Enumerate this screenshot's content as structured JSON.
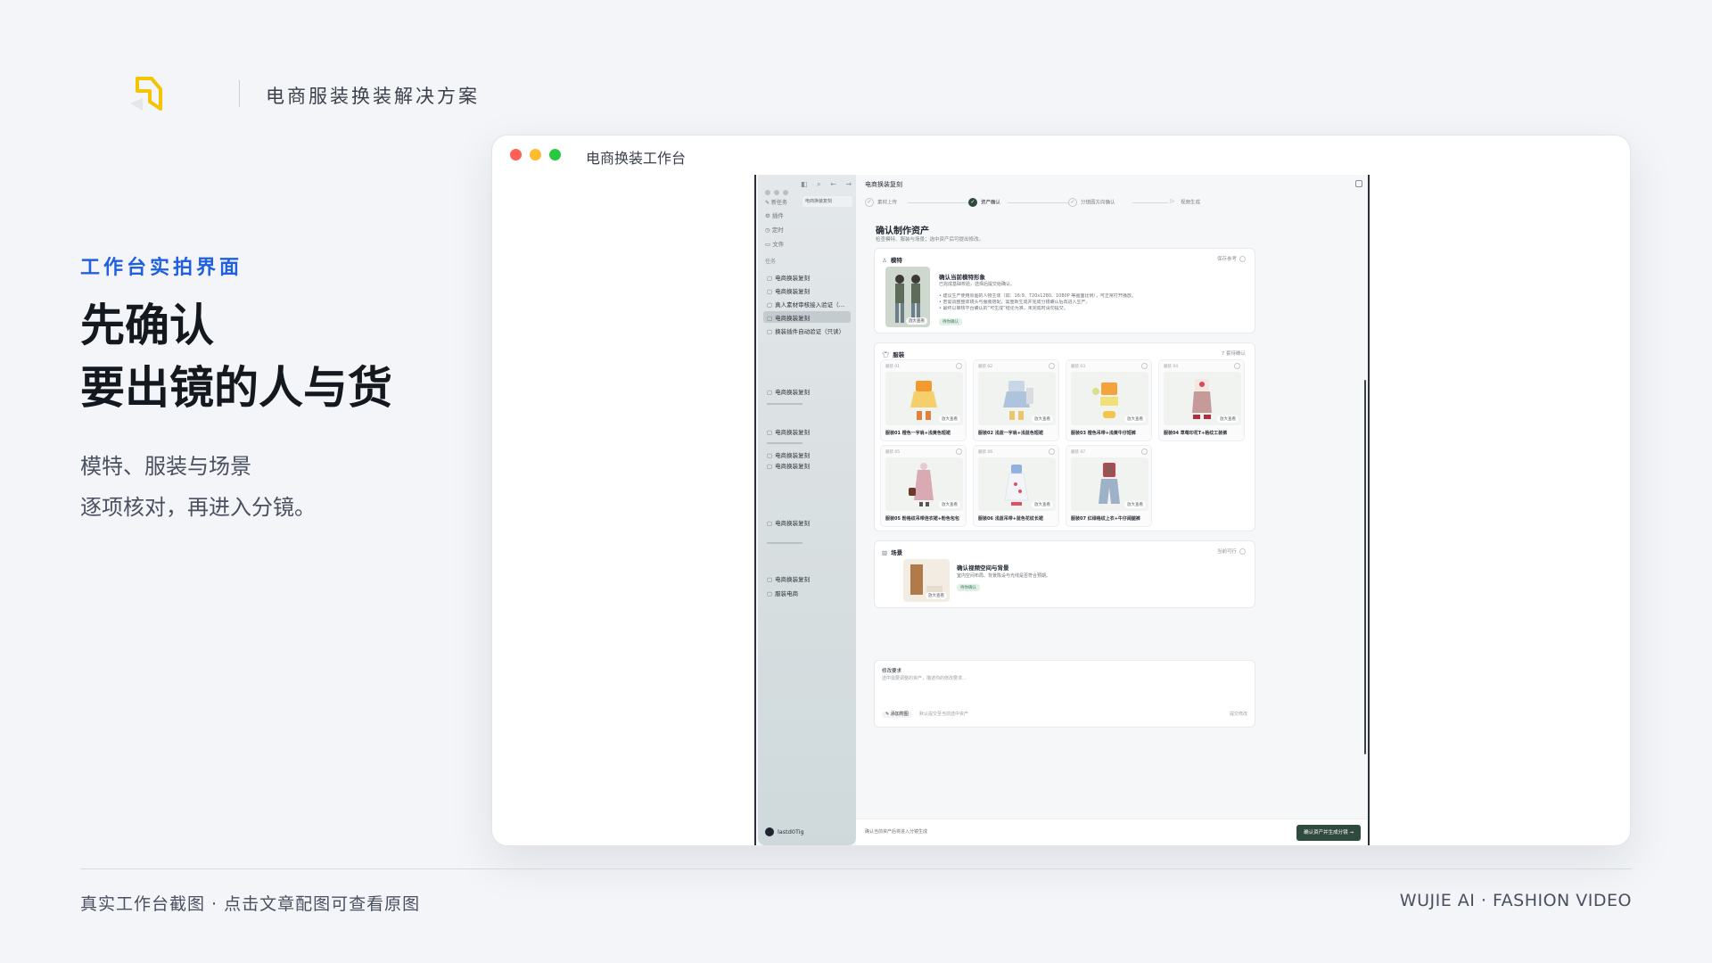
{
  "brand": {
    "logo_icon": "brand-logo-icon",
    "accent": "#f5c400"
  },
  "header": {
    "title": "电商服装换装解决方案"
  },
  "intro": {
    "eyebrow": "工作台实拍界面",
    "headline_line1": "先确认",
    "headline_line2": "要出镜的人与货",
    "sub_line1": "模特、服装与场景",
    "sub_line2": "逐项核对，再进入分镜。"
  },
  "footer": {
    "left": "真实工作台截图 · 点击文章配图可查看原图",
    "right": "WUJIE AI · FASHION VIDEO"
  },
  "window": {
    "title": "电商换装工作台"
  },
  "app": {
    "sidebar": {
      "new_label": "新任务",
      "tab_label": "电商换装复刻",
      "nav": [
        "插件",
        "定时",
        "文件"
      ],
      "section_label": "任务",
      "items": [
        "电商换装复刻",
        "电商换装复刻",
        "真人素材审核接入验证（…",
        "电商换装复刻",
        "换装插件自动验证（只读）",
        "电商换装复刻",
        "电商换装复刻",
        "电商换装复刻",
        "电商换装复刻",
        "电商换装复刻",
        "电商换装复刻",
        "服装电商"
      ],
      "user": "lastd0Tig"
    },
    "topbar_title": "电商换装复刻",
    "steps": [
      "素材上传",
      "资产确认",
      "分镜图方向确认",
      "视频生成"
    ],
    "page_title": "确认制作资产",
    "page_sub": "检查模特、服装与场景；选中资产后可提出修改。",
    "model": {
      "title": "模特",
      "right_label": "保存参考",
      "heading": "确认当前模特形象",
      "desc": "已完成基础校验，选择后提交给确认。",
      "bullets": [
        "建议生产使用原图的人物主体（如：16:9、720x1280、1080P 等画面比例），可正常打开播放。",
        "若需调整整体镜头与服装搭配，需重新生成并完成分镜确认后再进入生产。",
        "最终以审核平台确认的“可生成”结论为准，未完成时请勿提交。"
      ],
      "chip": "待你确认",
      "enlarge": "放大查看"
    },
    "garments": {
      "title": "服装",
      "right_label": "7 套待确认",
      "enlarge": "放大查看",
      "items": [
        {
          "num": "服装 01",
          "label": "服装01 橙色一字肩+浅黄色短裙"
        },
        {
          "num": "服装 02",
          "label": "服装02 浅蓝一字肩+浅蓝色短裙"
        },
        {
          "num": "服装 03",
          "label": "服装03 橙色吊带+浅黄牛仔短裤"
        },
        {
          "num": "服装 04",
          "label": "服装04 草莓印花T+格纹工装裤"
        },
        {
          "num": "服装 05",
          "label": "服装05 粉格纹吊带连衣裙+粉色包包"
        },
        {
          "num": "服装 06",
          "label": "服装06 浅蓝吊带+蓝色花纹长裙"
        },
        {
          "num": "服装 07",
          "label": "服装07 红绿格纹上衣+牛仔阔腿裤"
        }
      ]
    },
    "scene": {
      "title": "场景",
      "right_label": "当前可行",
      "heading": "确认视频空间与背景",
      "desc": "室内空间布局、背景陈设与光线是否符合预期。",
      "chip": "待你确认",
      "enlarge": "放大查看"
    },
    "revise": {
      "title": "修改要求",
      "placeholder": "选中需要调整的资产，描述你的修改要求…",
      "attach": "添加附图",
      "attach_hint": "默认提交至当前选中资产",
      "submit": "提交修改"
    },
    "bottom_hint": "确认当前资产后将进入分镜生成",
    "confirm_button": "确认资产并生成分镜 →"
  }
}
